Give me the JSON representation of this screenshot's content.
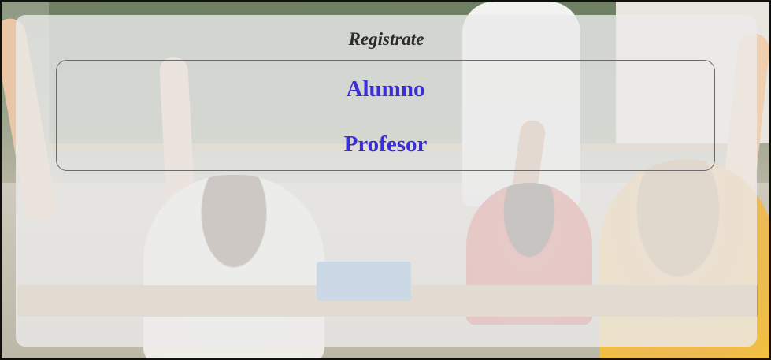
{
  "panel": {
    "title": "Registrate"
  },
  "options": {
    "alumno_label": "Alumno",
    "profesor_label": "Profesor"
  },
  "colors": {
    "link": "#3a2fd6",
    "title": "#2b2b2b",
    "panel_background": "rgba(235,235,235,0.80)"
  }
}
